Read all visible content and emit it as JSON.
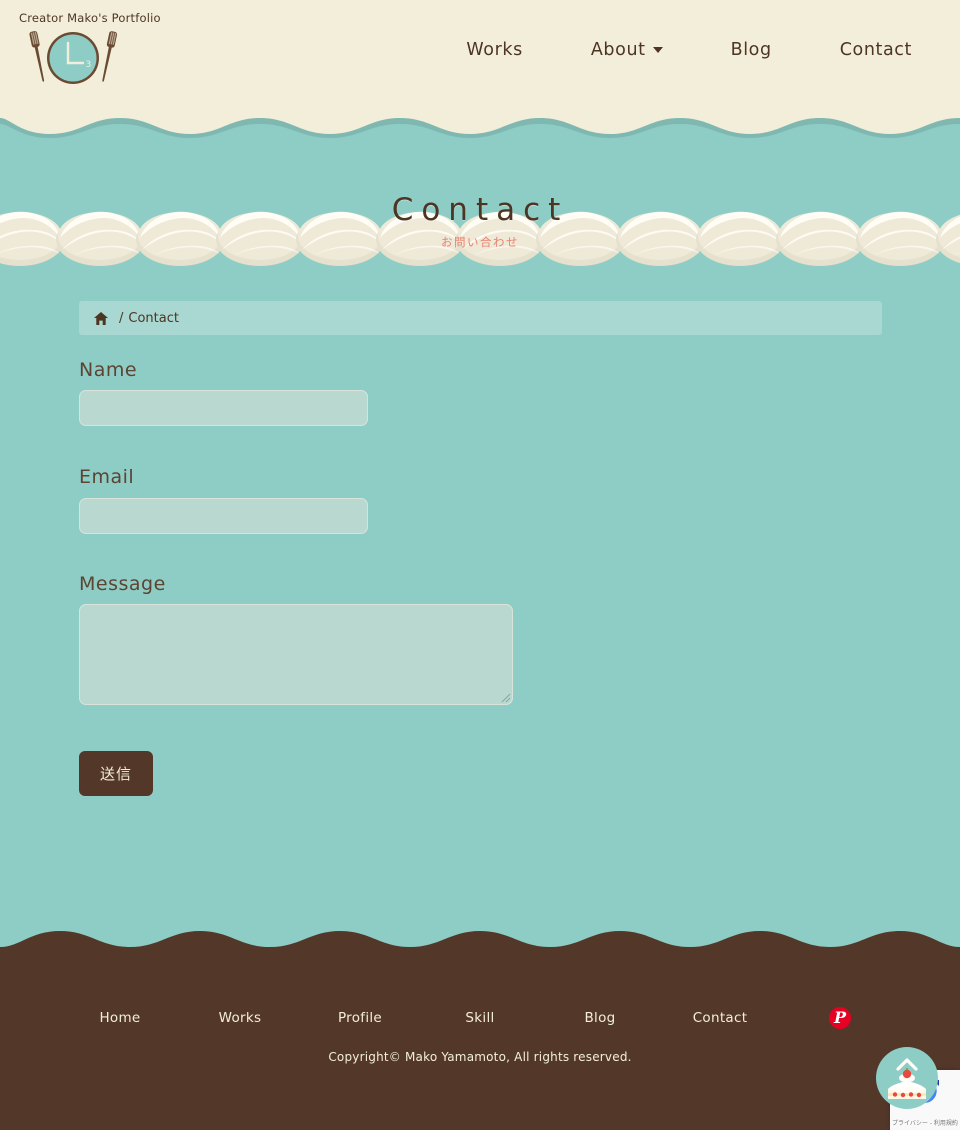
{
  "header": {
    "site_title": "Creator Mako's Portfolio",
    "logo_name": "plate-fork-knife-logo",
    "nav": [
      {
        "label": "Works",
        "has_dropdown": false
      },
      {
        "label": "About",
        "has_dropdown": true
      },
      {
        "label": "Blog",
        "has_dropdown": false
      },
      {
        "label": "Contact",
        "has_dropdown": false
      }
    ]
  },
  "hero": {
    "title": "Contact",
    "subtitle": "お問い合わせ"
  },
  "breadcrumb": {
    "home_icon": "home-icon",
    "separator": "/",
    "current": "Contact"
  },
  "form": {
    "name": {
      "label": "Name",
      "value": "",
      "placeholder": ""
    },
    "email": {
      "label": "Email",
      "value": "",
      "placeholder": ""
    },
    "message": {
      "label": "Message",
      "value": "",
      "placeholder": ""
    },
    "submit_label": "送信"
  },
  "footer": {
    "links": [
      {
        "label": "Home"
      },
      {
        "label": "Works"
      },
      {
        "label": "Profile"
      },
      {
        "label": "Skill"
      },
      {
        "label": "Blog"
      },
      {
        "label": "Contact"
      }
    ],
    "social": {
      "name": "pinterest-icon",
      "glyph": "P"
    },
    "copyright": "Copyright© Mako Yamamoto, All rights reserved."
  },
  "widgets": {
    "scroll_top": {
      "name": "scroll-to-top-cake-button"
    },
    "recaptcha": {
      "privacy": "プライバシー",
      "separator": " - ",
      "terms": "利用規約"
    }
  },
  "colors": {
    "cream": "#f3eed9",
    "teal": "#8ecdc6",
    "teal_light": "#a9d7d1",
    "input_fill": "#b9d9d0",
    "brown": "#53382a",
    "accent_salmon": "#e8836f",
    "pinterest_red": "#e60023"
  }
}
